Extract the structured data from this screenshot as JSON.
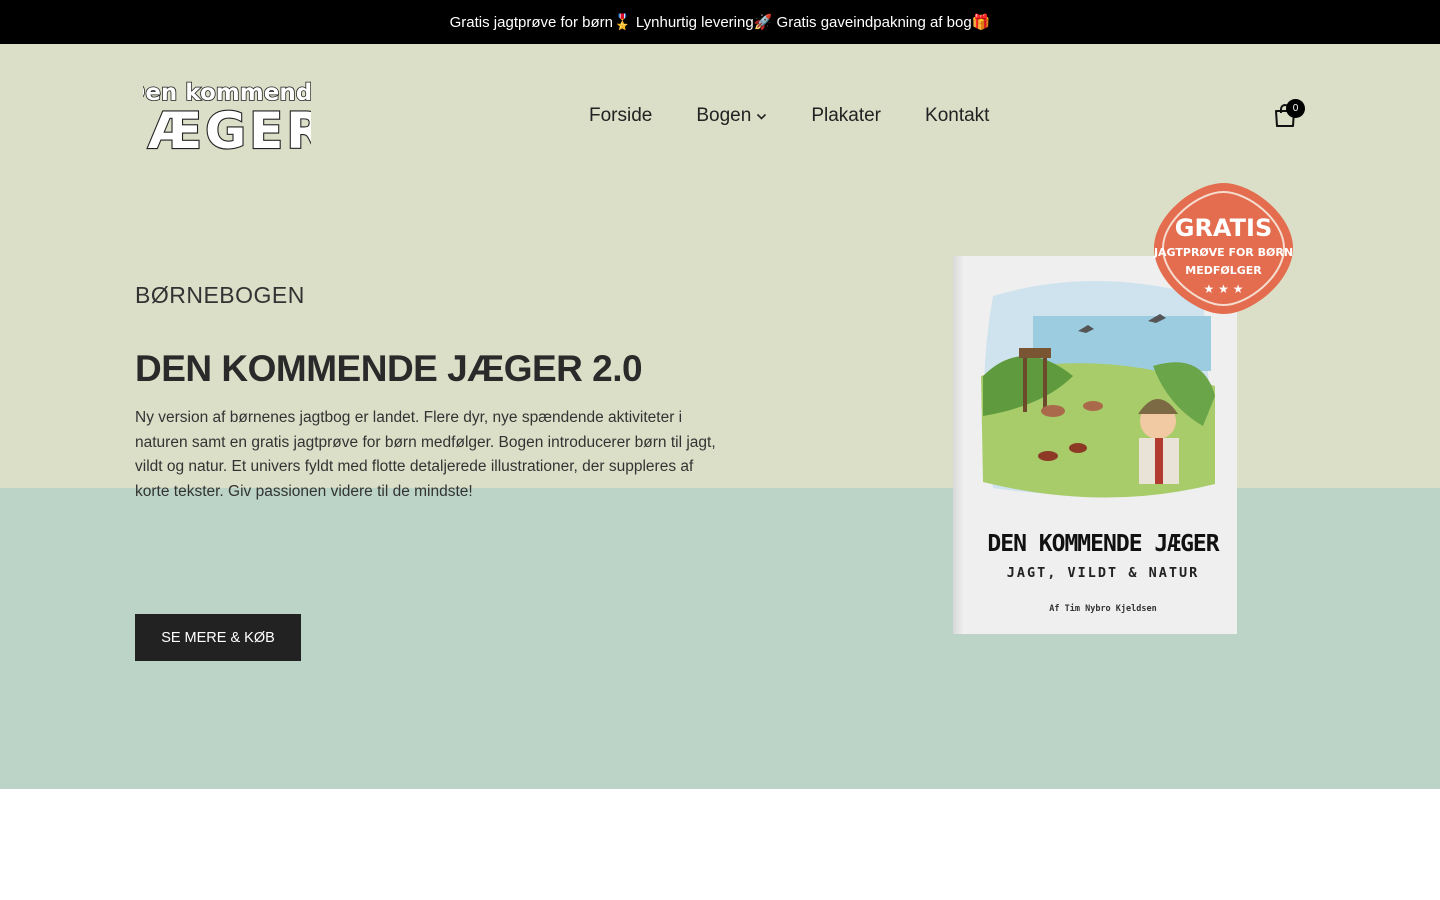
{
  "announcement": {
    "text": "Gratis jagtprøve for børn🎖️ Lynhurtig levering🚀 Gratis gaveindpakning af bog🎁"
  },
  "logo": {
    "line1": "Den kommende",
    "line2": "JÆGER"
  },
  "nav": {
    "items": [
      {
        "label": "Forside"
      },
      {
        "label": "Bogen"
      },
      {
        "label": "Plakater"
      },
      {
        "label": "Kontakt"
      }
    ]
  },
  "cart": {
    "count": "0",
    "icon": "shopping-bag-icon"
  },
  "hero": {
    "eyebrow": "BØRNEBOGEN",
    "headline": "DEN KOMMENDE JÆGER 2.0",
    "description": "Ny version af børnenes jagtbog er landet. Flere dyr, nye spændende aktiviteter i naturen samt en gratis jagtprøve for børn medfølger. Bogen introducerer børn til jagt, vildt og natur. Et univers fyldt med flotte detaljerede illustrationer, der suppleres af korte tekster. Giv passionen videre til de mindste!",
    "cta_label": "SE MERE & KØB"
  },
  "book": {
    "title": "DEN KOMMENDE JÆGER",
    "subtitle": "JAGT, VILDT & NATUR",
    "author": "Af Tim Nybro Kjeldsen"
  },
  "badge": {
    "line1": "GRATIS",
    "line2": "JAGTPRØVE FOR BØRN",
    "line3": "MEDFØLGER"
  },
  "colors": {
    "announcement_bg": "#000000",
    "hero_top_bg": "#dbdfc8",
    "hero_bottom_bg": "#bcd4c7",
    "cta_bg": "#222222",
    "badge_red": "#e36d4e"
  }
}
